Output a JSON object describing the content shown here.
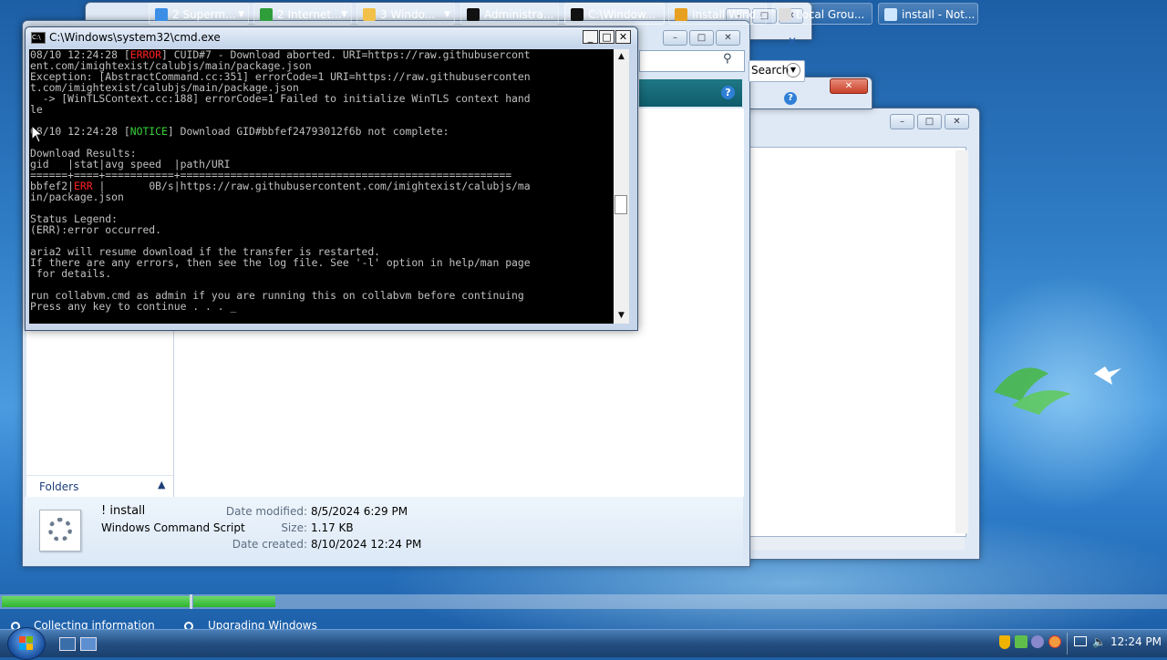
{
  "cmd": {
    "title": "C:\\Windows\\system32\\cmd.exe",
    "lines": [
      {
        "pre": "08/10 12:24:28 [",
        "hl": "ERROR",
        "post": "] CUID#7 - Download aborted. URI=https://raw.githubusercont",
        "color": "red"
      },
      {
        "pre": "ent.com/imightexist/calubjs/main/package.json",
        "hl": "",
        "post": "",
        "color": ""
      },
      {
        "pre": "Exception: [AbstractCommand.cc:351] errorCode=1 URI=https://raw.githubuserconten",
        "hl": "",
        "post": "",
        "color": ""
      },
      {
        "pre": "t.com/imightexist/calubjs/main/package.json",
        "hl": "",
        "post": "",
        "color": ""
      },
      {
        "pre": "  -> [WinTLSContext.cc:188] errorCode=1 Failed to initialize WinTLS context hand",
        "hl": "",
        "post": "",
        "color": ""
      },
      {
        "pre": "le",
        "hl": "",
        "post": "",
        "color": ""
      },
      {
        "pre": "",
        "hl": "",
        "post": "",
        "color": ""
      },
      {
        "pre": "08/10 12:24:28 [",
        "hl": "NOTICE",
        "post": "] Download GID#bbfef24793012f6b not complete:",
        "color": "grn"
      },
      {
        "pre": "",
        "hl": "",
        "post": "",
        "color": ""
      },
      {
        "pre": "Download Results:",
        "hl": "",
        "post": "",
        "color": ""
      },
      {
        "pre": "gid   |stat|avg speed  |path/URI",
        "hl": "",
        "post": "",
        "color": ""
      },
      {
        "pre": "======+====+===========+=====================================================",
        "hl": "",
        "post": "",
        "color": ""
      },
      {
        "pre": "bbfef2|",
        "hl": "ERR",
        "post": " |       0B/s|https://raw.githubusercontent.com/imightexist/calubjs/ma",
        "color": "red"
      },
      {
        "pre": "in/package.json",
        "hl": "",
        "post": "",
        "color": ""
      },
      {
        "pre": "",
        "hl": "",
        "post": "",
        "color": ""
      },
      {
        "pre": "Status Legend:",
        "hl": "",
        "post": "",
        "color": ""
      },
      {
        "pre": "(ERR):error occurred.",
        "hl": "",
        "post": "",
        "color": ""
      },
      {
        "pre": "",
        "hl": "",
        "post": "",
        "color": ""
      },
      {
        "pre": "aria2 will resume download if the transfer is restarted.",
        "hl": "",
        "post": "",
        "color": ""
      },
      {
        "pre": "If there are any errors, then see the log file. See '-l' option in help/man page",
        "hl": "",
        "post": "",
        "color": ""
      },
      {
        "pre": " for details.",
        "hl": "",
        "post": "",
        "color": ""
      },
      {
        "pre": "",
        "hl": "",
        "post": "",
        "color": ""
      },
      {
        "pre": "run collabvm.cmd as admin if you are running this on collabvm before continuing",
        "hl": "",
        "post": "",
        "color": ""
      },
      {
        "pre": "Press any key to continue . . . _",
        "hl": "",
        "post": "",
        "color": ""
      }
    ]
  },
  "explorer": {
    "search_label": "Search",
    "folders_label": "Folders"
  },
  "details": {
    "file_name": "! install",
    "file_type": "Windows Command Script",
    "modified_label": "Date modified:",
    "modified_value": "8/5/2024 6:29 PM",
    "size_label": "Size:",
    "size_value": "1.17 KB",
    "created_label": "Date created:",
    "created_value": "8/10/2024 12:24 PM"
  },
  "setup": {
    "step1": "Collecting information",
    "step2": "Upgrading Windows",
    "progress_fraction_1": 1.0,
    "progress_fraction_2": 0.3
  },
  "taskbar": {
    "items": [
      {
        "label": "2 Superm...",
        "icon": "ie-icon",
        "color": "#3a8ee6"
      },
      {
        "label": "2 Internet...",
        "icon": "ie-icon",
        "color": "#2e9d3a"
      },
      {
        "label": "3 Windo...",
        "icon": "folder-icon",
        "color": "#f2c14a"
      },
      {
        "label": "Administra...",
        "icon": "cmd-icon",
        "color": "#111111"
      },
      {
        "label": "C:\\Window...",
        "icon": "cmd-icon",
        "color": "#111111"
      },
      {
        "label": "Install Wind...",
        "icon": "windows-flag-icon",
        "color": "#e8a020"
      },
      {
        "label": "Local Grou...",
        "icon": "document-icon",
        "color": "#dddddd"
      },
      {
        "label": "install - Not...",
        "icon": "notepad-icon",
        "color": "#cfe6ff"
      }
    ],
    "clock": "12:24 PM"
  }
}
